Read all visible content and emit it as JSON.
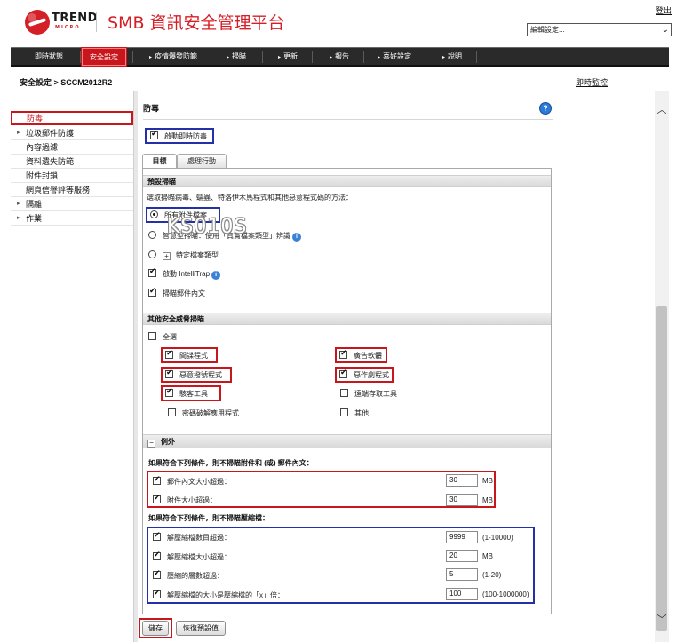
{
  "header": {
    "brand": "TREND",
    "brand_sub": "MICRO",
    "app_title": "SMB 資訊安全管理平台",
    "logout": "登出",
    "edit_select": "編輯設定..."
  },
  "nav": {
    "items": [
      {
        "label": "即時狀態"
      },
      {
        "label": "安全設定"
      },
      {
        "label": "疫情爆發防範"
      },
      {
        "label": "掃瞄"
      },
      {
        "label": "更新"
      },
      {
        "label": "報告"
      },
      {
        "label": "喜好設定"
      },
      {
        "label": "說明"
      }
    ]
  },
  "breadcrumb": "安全設定 > SCCM2012R2",
  "realtime_monitor": "即時監控",
  "sidebar": {
    "items": [
      {
        "label": "防毒"
      },
      {
        "label": "垃圾郵件防護"
      },
      {
        "label": "內容過濾"
      },
      {
        "label": "資料遺失防範"
      },
      {
        "label": "附件封鎖"
      },
      {
        "label": "網頁信譽評等服務"
      },
      {
        "label": "隔離"
      },
      {
        "label": "作業"
      }
    ]
  },
  "main": {
    "title": "防毒",
    "enable_realtime": "啟動即時防毒",
    "tabs": [
      {
        "label": "目標"
      },
      {
        "label": "處理行動"
      }
    ],
    "default_scan": {
      "header": "預設掃瞄",
      "intro": "選取掃瞄病毒、蠕蟲、特洛伊木馬程式和其他惡意程式碼的方法：",
      "all_attachments": "所有附件檔案",
      "intelliscan": "智慧型掃瞄：使用「真實檔案類型」辨識",
      "specific_types": "特定檔案類型",
      "intellitrap": "啟動 IntelliTrap",
      "scan_body": "掃瞄郵件內文"
    },
    "other_threats": {
      "header": "其他安全威脅掃瞄",
      "select_all": "全選",
      "spyware": "間諜程式",
      "adware": "廣告軟體",
      "dialer": "惡意撥號程式",
      "joke": "惡作劇程式",
      "hacking": "駭客工具",
      "remote_access": "遠端存取工具",
      "password_crack": "密碼破解應用程式",
      "other": "其他"
    },
    "exceptions": {
      "header": "例外",
      "attach_title": "如果符合下列條件，則不掃瞄附件和 (或) 郵件內文：",
      "body_size": "郵件內文大小超過：",
      "body_size_value": "30",
      "body_size_unit": "MB",
      "attach_size": "附件大小超過：",
      "attach_size_value": "30",
      "attach_size_unit": "MB",
      "archive_title": "如果符合下列條件，則不掃瞄壓縮檔：",
      "file_count": "解壓縮檔數目超過：",
      "file_count_value": "9999",
      "file_count_range": "(1-10000)",
      "decompressed_size": "解壓縮檔大小超過：",
      "decompressed_size_value": "20",
      "decompressed_size_unit": "MB",
      "layers": "壓縮的層數超過：",
      "layers_value": "5",
      "layers_range": "(1-20)",
      "ratio": "解壓縮檔的大小是壓縮檔的「x」倍：",
      "ratio_value": "100",
      "ratio_range": "(100-1000000)"
    },
    "save_button": "儲存",
    "reset_button": "恢復預設值"
  },
  "watermark": "KS010S"
}
